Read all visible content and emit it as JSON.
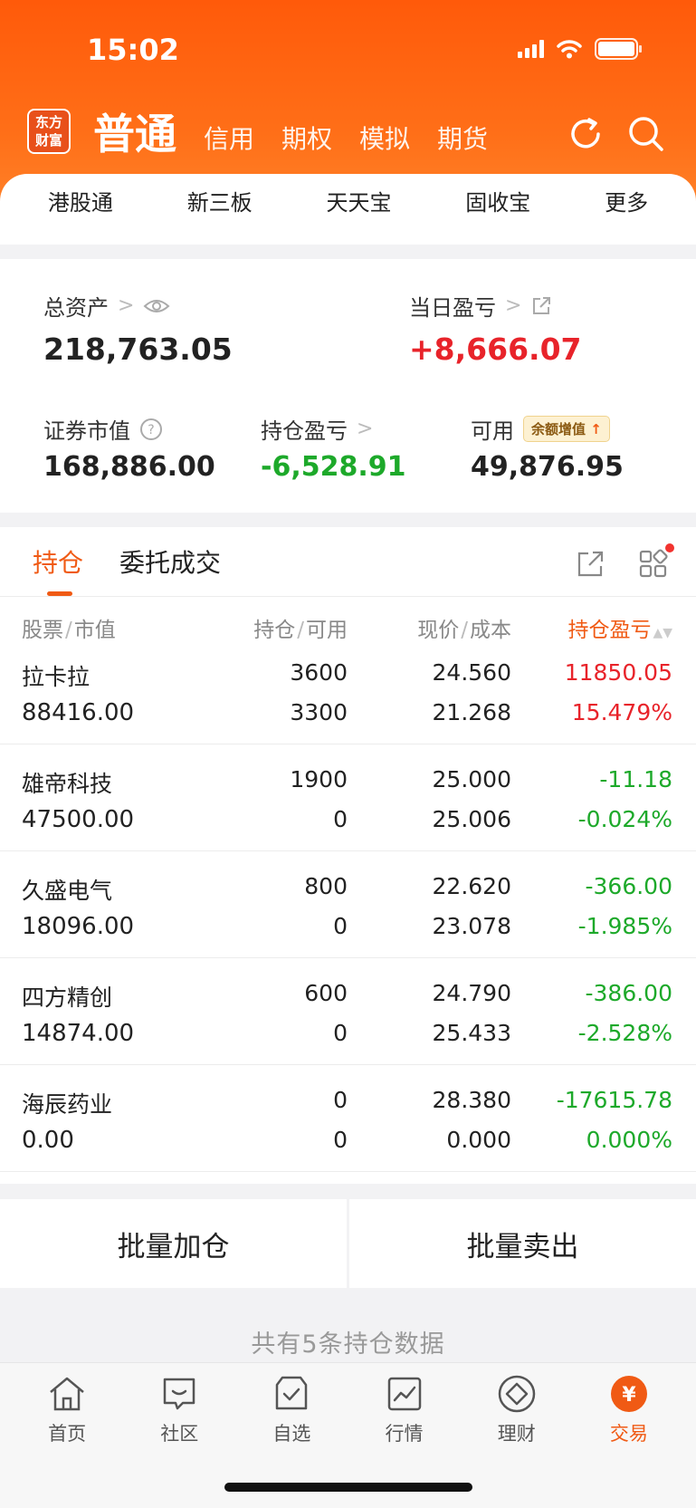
{
  "status": {
    "time": "15:02"
  },
  "header": {
    "logo_line1": "东方",
    "logo_line2": "财富",
    "tabs": [
      {
        "label": "普通",
        "active": true
      },
      {
        "label": "信用"
      },
      {
        "label": "期权"
      },
      {
        "label": "模拟"
      },
      {
        "label": "期货"
      }
    ],
    "quick_links": [
      "港股通",
      "新三板",
      "天天宝",
      "固收宝",
      "更多"
    ]
  },
  "assets": {
    "total_label": "总资产",
    "total_value": "218,763.05",
    "daily_pnl_label": "当日盈亏",
    "daily_pnl_value": "+8,666.07",
    "securities_label": "证券市值",
    "securities_value": "168,886.00",
    "position_pnl_label": "持仓盈亏",
    "position_pnl_value": "-6,528.91",
    "available_label": "可用",
    "available_value": "49,876.95",
    "available_badge": "余额增值"
  },
  "positions": {
    "tabs": [
      "持仓",
      "委托成交"
    ],
    "col_stock": "股票",
    "col_mv": "市值",
    "col_hold": "持仓",
    "col_avail": "可用",
    "col_price": "现价",
    "col_cost": "成本",
    "col_pnl": "持仓盈亏",
    "rows": [
      {
        "name": "拉卡拉",
        "market_value": "88416.00",
        "hold": "3600",
        "available": "3300",
        "price": "24.560",
        "cost": "21.268",
        "pnl": "11850.05",
        "pnl_pct": "15.479%",
        "trend": "up"
      },
      {
        "name": "雄帝科技",
        "market_value": "47500.00",
        "hold": "1900",
        "available": "0",
        "price": "25.000",
        "cost": "25.006",
        "pnl": "-11.18",
        "pnl_pct": "-0.024%",
        "trend": "down"
      },
      {
        "name": "久盛电气",
        "market_value": "18096.00",
        "hold": "800",
        "available": "0",
        "price": "22.620",
        "cost": "23.078",
        "pnl": "-366.00",
        "pnl_pct": "-1.985%",
        "trend": "down"
      },
      {
        "name": "四方精创",
        "market_value": "14874.00",
        "hold": "600",
        "available": "0",
        "price": "24.790",
        "cost": "25.433",
        "pnl": "-386.00",
        "pnl_pct": "-2.528%",
        "trend": "down"
      },
      {
        "name": "海辰药业",
        "market_value": "0.00",
        "hold": "0",
        "available": "0",
        "price": "28.380",
        "cost": "0.000",
        "pnl": "-17615.78",
        "pnl_pct": "0.000%",
        "trend": "down"
      }
    ]
  },
  "actions": {
    "batch_add": "批量加仓",
    "batch_sell": "批量卖出"
  },
  "summary": "共有5条持仓数据",
  "tabbar": [
    {
      "label": "首页",
      "icon": "home-icon"
    },
    {
      "label": "社区",
      "icon": "community-icon"
    },
    {
      "label": "自选",
      "icon": "watchlist-icon"
    },
    {
      "label": "行情",
      "icon": "market-icon"
    },
    {
      "label": "理财",
      "icon": "wealth-icon"
    },
    {
      "label": "交易",
      "icon": "trade-icon",
      "active": true
    }
  ],
  "colors": {
    "brand_orange": "#ff5a0a",
    "up_red": "#e8232a",
    "down_green": "#1da92a",
    "active_tab": "#f05a14"
  }
}
